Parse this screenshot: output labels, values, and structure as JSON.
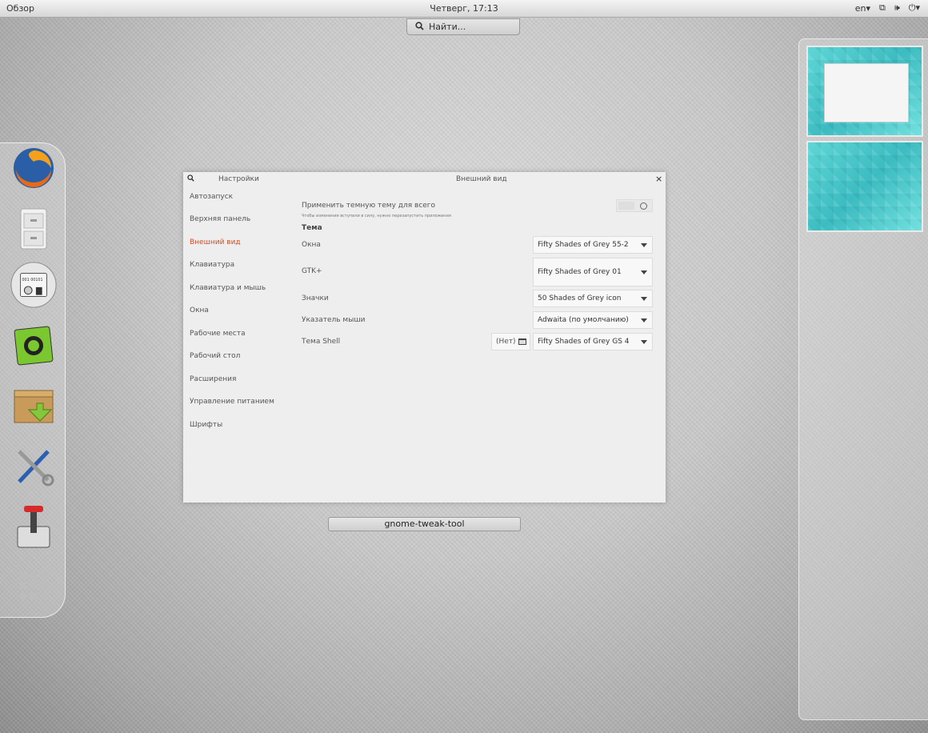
{
  "topbar": {
    "activities": "Обзор",
    "clock": "Четверг, 17:13",
    "keyboard_layout": "en"
  },
  "search": {
    "placeholder": "Найти..."
  },
  "dash": {
    "apps": [
      "firefox-icon",
      "file-cabinet-icon",
      "system-monitor-icon",
      "software-center-icon",
      "package-installer-icon",
      "tools-icon",
      "joystick-icon",
      "show-apps-icon"
    ]
  },
  "window": {
    "header_left": "Настройки",
    "header_title": "Внешний вид",
    "close": "×",
    "sidebar": [
      {
        "label": "Автозапуск"
      },
      {
        "label": "Верхняя панель"
      },
      {
        "label": "Внешний вид"
      },
      {
        "label": "Клавиатура"
      },
      {
        "label": "Клавиатура и мышь"
      },
      {
        "label": "Окна"
      },
      {
        "label": "Рабочие места"
      },
      {
        "label": "Рабочий стол"
      },
      {
        "label": "Расширения"
      },
      {
        "label": "Управление питанием"
      },
      {
        "label": "Шрифты"
      }
    ],
    "dark_theme_label": "Применить темную тему для всего",
    "dark_theme_hint": "Чтобы изменения вступили в силу, нужно перезапустить приложения",
    "section_theme": "Тема",
    "rows": [
      {
        "label": "Окна",
        "value": "Fifty Shades of Grey 55-2"
      },
      {
        "label": "GTK+",
        "value": "Fifty Shades of Grey 01"
      },
      {
        "label": "Значки",
        "value": "50 Shades of Grey icon"
      },
      {
        "label": "Указатель мыши",
        "value": "Adwaita (по умолчанию)"
      },
      {
        "label": "Тема Shell",
        "value": "Fifty Shades of Grey GS 4"
      }
    ],
    "shell_none": "(Нет)"
  },
  "window_caption": "gnome-tweak-tool",
  "colors": {
    "accent": "#d54b1e",
    "workspace": "#4cc9cc"
  }
}
